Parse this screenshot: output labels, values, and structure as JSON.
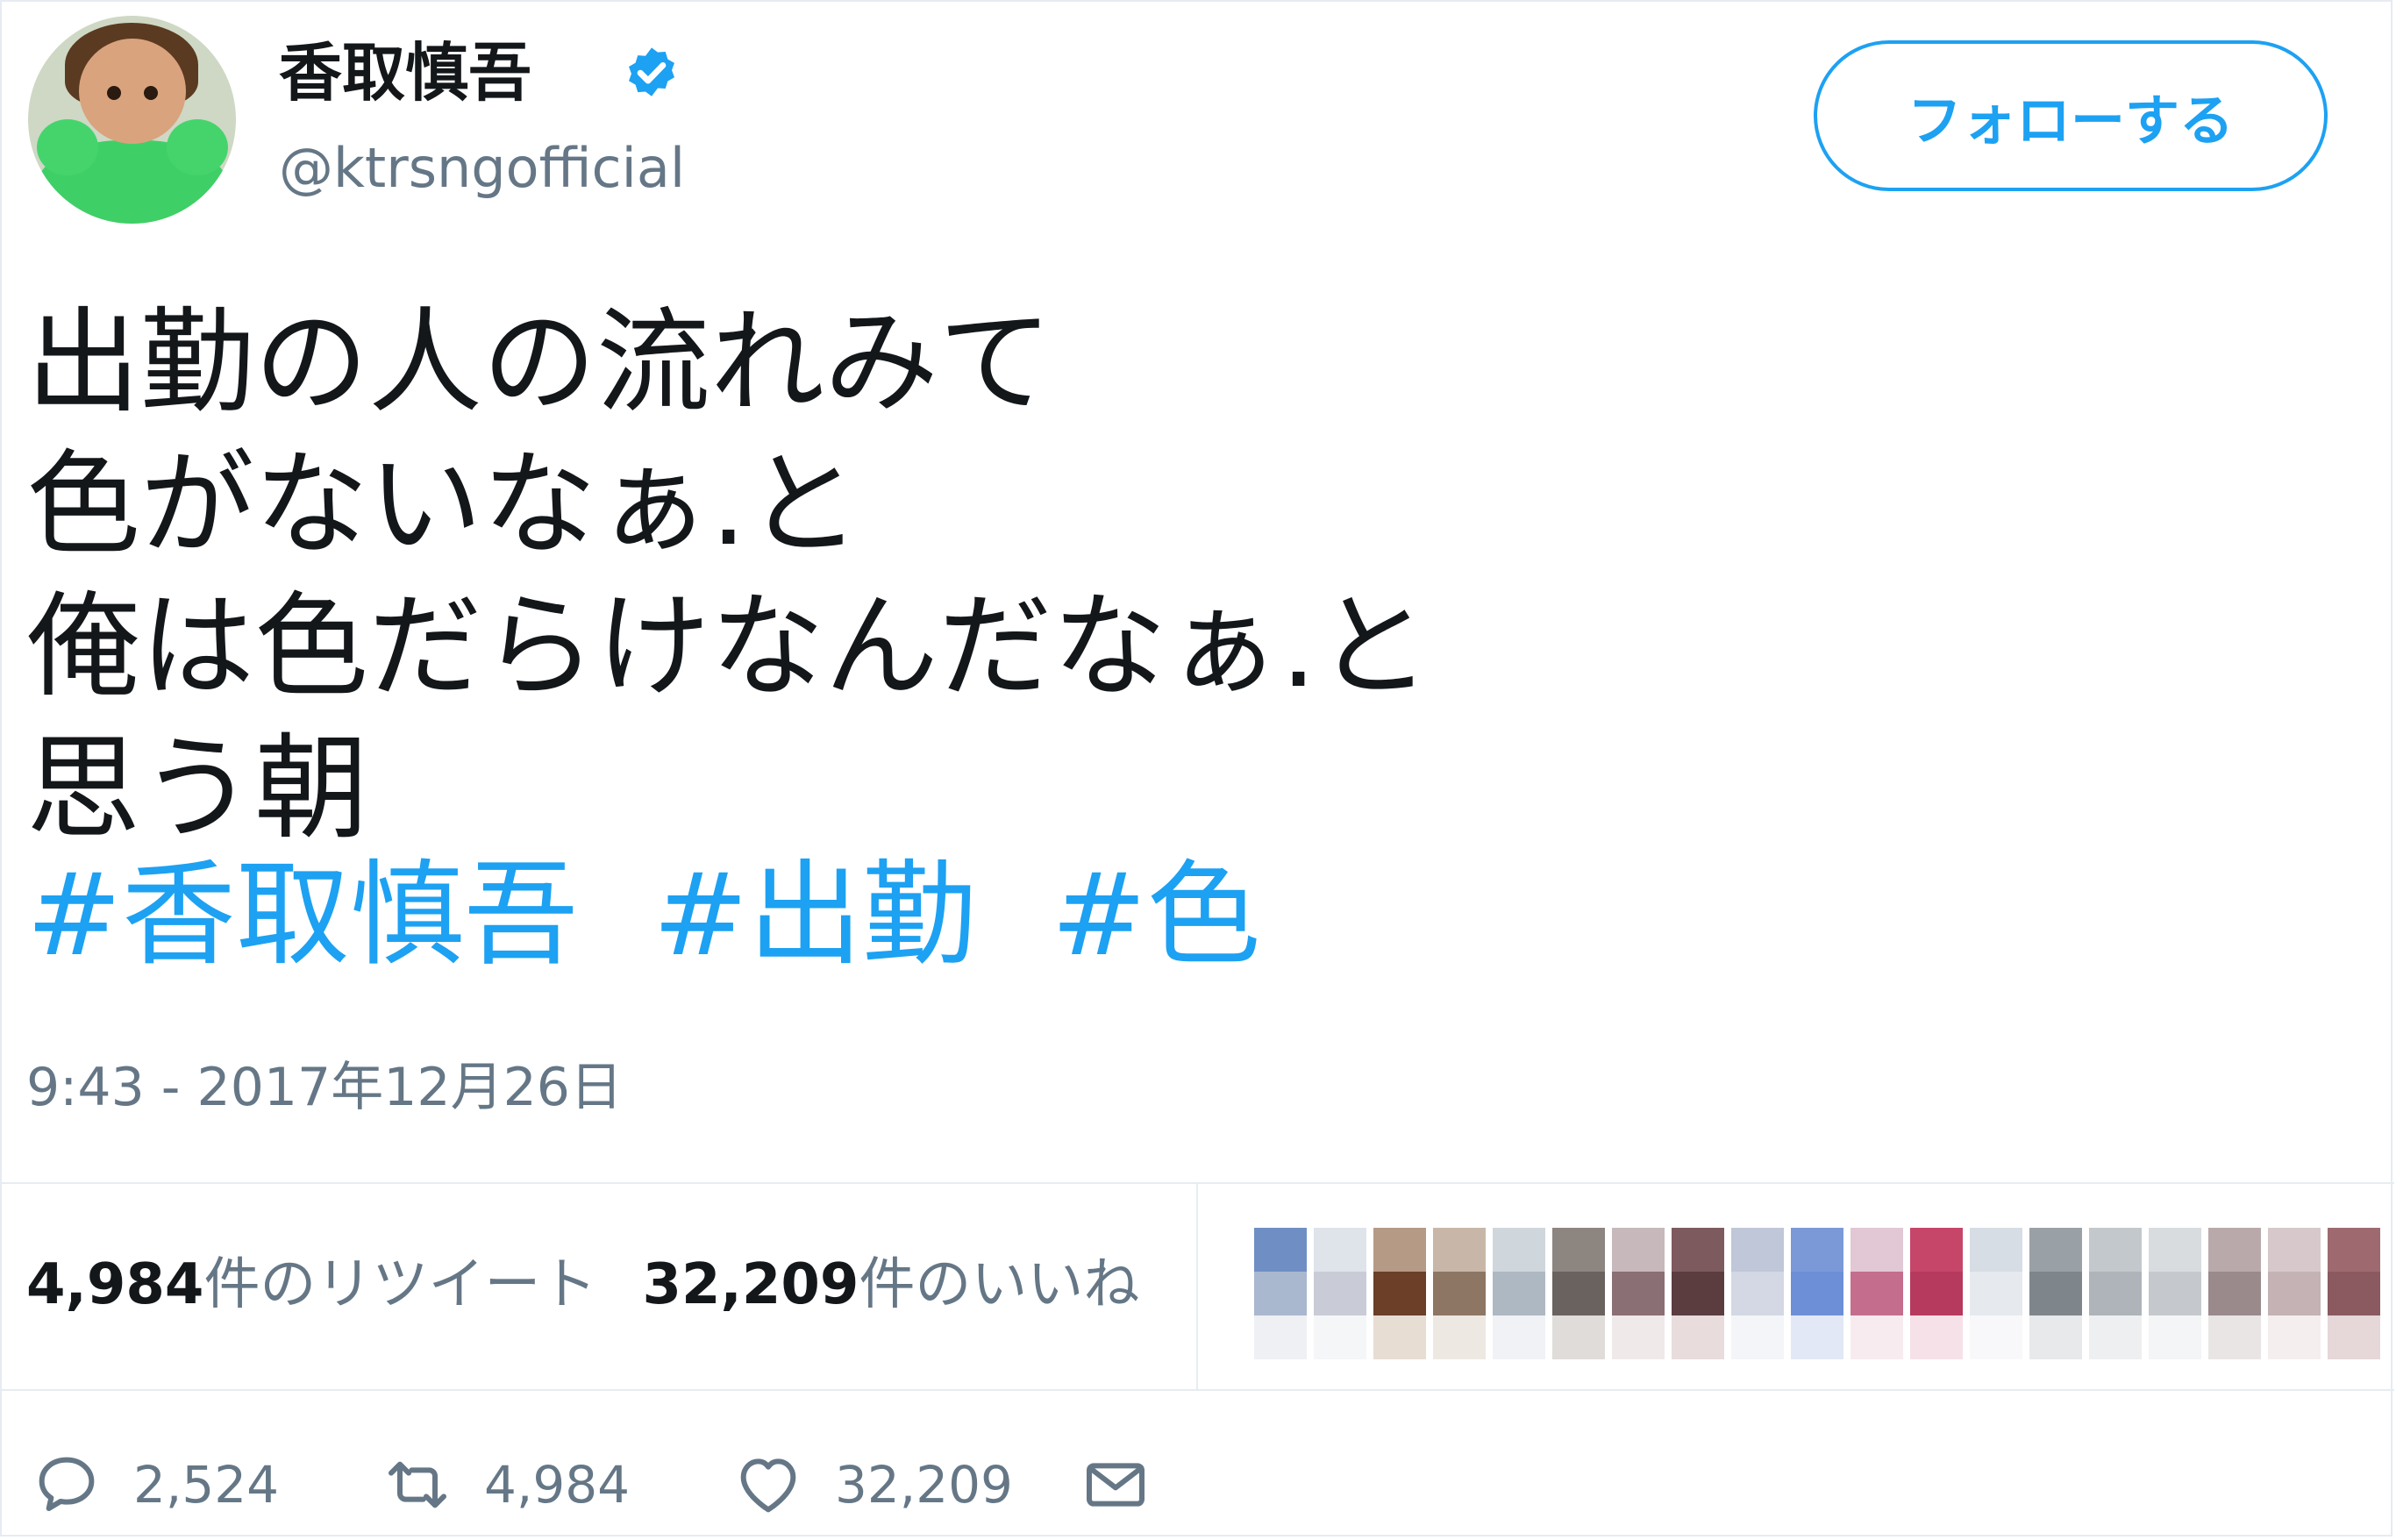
{
  "user": {
    "display_name": "香取慎吾",
    "handle": "@ktrsngofficial",
    "verified": true
  },
  "follow_button_label": "フォローする",
  "tweet": {
    "lines": [
      "出勤の人の流れみて",
      "色がないなぁ.と",
      "俺は色だらけなんだなぁ.と",
      "思う朝"
    ],
    "hashtags": [
      "#香取慎吾",
      "#出勤",
      "#色"
    ]
  },
  "timestamp": "9:43 - 2017年12月26日",
  "stats": {
    "retweets_count": "4,984",
    "retweets_label": "件のリツイート",
    "likes_count": "32,209",
    "likes_label": "件のいいね"
  },
  "actions": {
    "reply_count": "2,524",
    "retweet_count": "4,984",
    "like_count": "32,209"
  },
  "colors": {
    "accent": "#1da1f2",
    "secondary_text": "#657786",
    "primary_text": "#14171a",
    "border": "#e6ecf0"
  },
  "icons": {
    "verified": "verified-badge-icon",
    "reply": "reply-icon",
    "retweet": "retweet-icon",
    "like": "heart-icon",
    "dm": "envelope-icon"
  }
}
